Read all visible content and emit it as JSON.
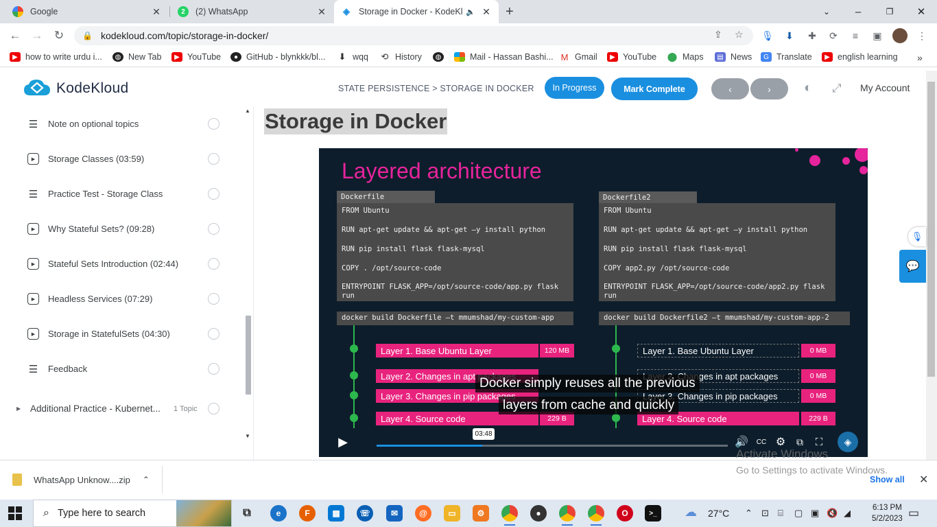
{
  "browser": {
    "tabs": [
      {
        "title": "Google",
        "active": false
      },
      {
        "title": "(2) WhatsApp",
        "active": false
      },
      {
        "title": "Storage in Docker - KodeKlo",
        "active": true
      }
    ],
    "url": "kodekloud.com/topic/storage-in-docker/",
    "bookmarks": [
      "how to write urdu i...",
      "New Tab",
      "YouTube",
      "GitHub - blynkkk/bl...",
      "wqq",
      "History",
      "Mail - Hassan Bashi...",
      "Gmail",
      "YouTube",
      "Maps",
      "News",
      "Translate",
      "english learning"
    ]
  },
  "header": {
    "logo": "KodeKloud",
    "breadcrumb": "STATE PERSISTENCE > STORAGE IN DOCKER",
    "status_label": "In Progress",
    "complete_label": "Mark Complete",
    "prev_label": "‹",
    "next_label": "›",
    "account_label": "My Account"
  },
  "sidebar": {
    "items": [
      {
        "type": "text",
        "label": "Note on optional topics"
      },
      {
        "type": "video",
        "label": "Storage Classes (03:59)"
      },
      {
        "type": "text",
        "label": "Practice Test - Storage Class"
      },
      {
        "type": "video",
        "label": "Why Stateful Sets? (09:28)"
      },
      {
        "type": "video",
        "label": "Stateful Sets Introduction (02:44)"
      },
      {
        "type": "video",
        "label": "Headless Services (07:29)"
      },
      {
        "type": "video",
        "label": "Storage in StatefulSets (04:30)"
      },
      {
        "type": "text",
        "label": "Feedback"
      }
    ],
    "section": {
      "label": "Additional Practice - Kubernet...",
      "count": "1 Topic"
    }
  },
  "lesson": {
    "title": "Storage in Docker"
  },
  "slide": {
    "title": "Layered architecture",
    "left": {
      "file_tab": "Dockerfile",
      "code": [
        "FROM Ubuntu",
        "RUN apt-get update && apt-get –y install python",
        "RUN pip install flask flask-mysql",
        "COPY . /opt/source-code",
        "ENTRYPOINT FLASK_APP=/opt/source-code/app.py flask\nrun"
      ],
      "build": "docker build Dockerfile –t mmumshad/my-custom-app",
      "layers": [
        {
          "label": "Layer 1. Base Ubuntu Layer",
          "size": "120 MB"
        },
        {
          "label": "Layer 2. Changes in apt packages",
          "size": ""
        },
        {
          "label": "Layer 3. Changes in pip packages",
          "size": ""
        },
        {
          "label": "Layer 4. Source code",
          "size": "229 B"
        }
      ]
    },
    "right": {
      "file_tab": "Dockerfile2",
      "code": [
        "FROM Ubuntu",
        "RUN apt-get update && apt-get –y install python",
        "RUN pip install flask flask-mysql",
        "COPY app2.py /opt/source-code",
        "ENTRYPOINT FLASK_APP=/opt/source-code/app2.py flask\nrun"
      ],
      "build": "docker build Dockerfile2 –t mmumshad/my-custom-app-2",
      "layers": [
        {
          "label": "Layer 1. Base Ubuntu Layer",
          "size": "0 MB"
        },
        {
          "label": "Layer 2. Changes in apt packages",
          "size": "0 MB"
        },
        {
          "label": "Layer 3. Changes in pip packages",
          "size": "0 MB"
        },
        {
          "label": "Layer 4. Source code",
          "size": "229 B"
        }
      ]
    },
    "caption_line1": "Docker simply reuses all the previous",
    "caption_line2": "layers from cache and quickly"
  },
  "player": {
    "time_tooltip": "03:48",
    "progress_fraction": 0.3
  },
  "watermark": {
    "line1": "Activate Windows",
    "line2": "Go to Settings to activate Windows."
  },
  "downloads": {
    "file": "WhatsApp Unknow....zip",
    "show_all": "Show all"
  },
  "taskbar": {
    "search_placeholder": "Type here to search",
    "weather": "27°C",
    "time": "6:13 PM",
    "date": "5/2/2023"
  },
  "colors": {
    "accent": "#1a8fe0",
    "slide_pink": "#e8237e",
    "layer_green": "#2db84d"
  }
}
